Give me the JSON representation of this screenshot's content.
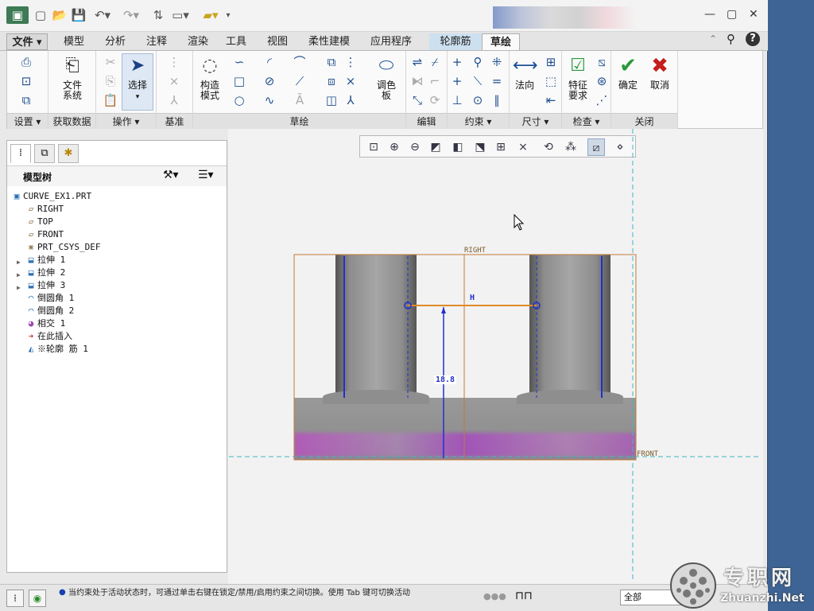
{
  "ribbon_tabs": [
    "文件",
    "模型",
    "分析",
    "注释",
    "渲染",
    "工具",
    "视图",
    "柔性建模",
    "应用程序",
    "轮廓筋",
    "草绘"
  ],
  "ribbon": {
    "big_buttons": [
      "文件系统",
      "选择",
      "构造模式",
      "调色板",
      "法向",
      "特征要求",
      "确定",
      "取消"
    ],
    "group_labels": [
      "设置",
      "获取数据",
      "操作",
      "基准",
      "草绘",
      "编辑",
      "约束",
      "尺寸",
      "检查",
      "关闭"
    ]
  },
  "model_tree": {
    "title": "模型树",
    "items": [
      {
        "label": "CURVE_EX1.PRT",
        "icon": "part-icon",
        "level": 0
      },
      {
        "label": "RIGHT",
        "icon": "datum-plane-icon",
        "level": 1
      },
      {
        "label": "TOP",
        "icon": "datum-plane-icon",
        "level": 1
      },
      {
        "label": "FRONT",
        "icon": "datum-plane-icon",
        "level": 1
      },
      {
        "label": "PRT_CSYS_DEF",
        "icon": "csys-icon",
        "level": 1
      },
      {
        "label": "拉伸 1",
        "icon": "extrude-icon",
        "level": 1,
        "expandable": true
      },
      {
        "label": "拉伸 2",
        "icon": "extrude-icon",
        "level": 1,
        "expandable": true
      },
      {
        "label": "拉伸 3",
        "icon": "extrude-icon",
        "level": 1,
        "expandable": true
      },
      {
        "label": "倒圆角 1",
        "icon": "round-icon",
        "level": 1
      },
      {
        "label": "倒圆角 2",
        "icon": "round-icon",
        "level": 1
      },
      {
        "label": "相交 1",
        "icon": "intersect-icon",
        "level": 1
      },
      {
        "label": "在此插入",
        "icon": "insert-arrow-icon",
        "level": 1
      },
      {
        "label": "※轮廓 筋 1",
        "icon": "rib-icon",
        "level": 1
      }
    ]
  },
  "sketch": {
    "ref_right": "RIGHT",
    "ref_front": "FRONT",
    "dim_h": "H",
    "dim_value": "18.8"
  },
  "status": {
    "message": "当约束处于活动状态时，可通过单击右键在锁定/禁用/启用约束之间切换。使用 Tab 键可切换活动",
    "filter": "全部"
  },
  "watermark": {
    "cn": "专职网",
    "url": "Zhuanzhi.Net"
  },
  "colors": {
    "desktop": "#3d6494",
    "accent": "#2a5d9c",
    "ok": "#2a9a3a",
    "cancel": "#c41e1e"
  }
}
